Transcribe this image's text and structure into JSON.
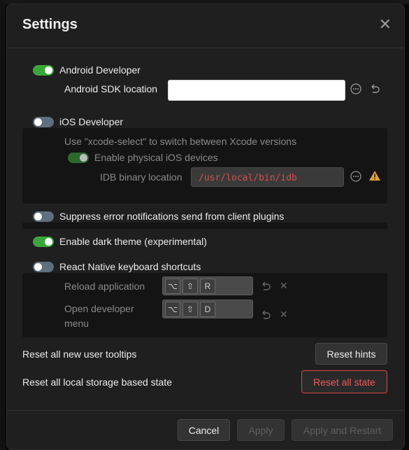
{
  "modal": {
    "title": "Settings"
  },
  "android": {
    "toggle_label": "Android Developer",
    "enabled": true,
    "sdk_label": "Android SDK location",
    "sdk_value": ""
  },
  "ios": {
    "toggle_label": "iOS Developer",
    "enabled": false,
    "xcode_hint": "Use \"xcode-select\" to switch between Xcode versions",
    "physical_label": "Enable physical iOS devices",
    "idb_label": "IDB binary location",
    "idb_value": "/usr/local/bin/idb"
  },
  "suppress": {
    "label": "Suppress error notifications send from client plugins",
    "enabled": false
  },
  "dark_theme": {
    "label": "Enable dark theme (experimental)",
    "enabled": true
  },
  "rn_shortcuts": {
    "label": "React Native keyboard shortcuts",
    "enabled": false,
    "reload_label": "Reload application",
    "reload_keys": [
      "⌥",
      "⇧",
      "R"
    ],
    "devmenu_label_line1": "Open developer",
    "devmenu_label_line2": "menu",
    "devmenu_keys": [
      "⌥",
      "⇧",
      "D"
    ]
  },
  "tooltips": {
    "label": "Reset all new user tooltips",
    "button": "Reset hints"
  },
  "storage": {
    "label": "Reset all local storage based state",
    "button": "Reset all state"
  },
  "footer": {
    "cancel": "Cancel",
    "apply": "Apply",
    "apply_restart": "Apply and Restart"
  },
  "icons": {
    "close": "close-icon",
    "more": "more-options-icon",
    "undo": "undo-icon",
    "warning": "warning-icon",
    "clear": "clear-icon"
  },
  "colors": {
    "toggle_on": "#3aa63a",
    "toggle_off": "#5f6f7d",
    "danger": "#e04545",
    "warning": "#e0a030"
  }
}
